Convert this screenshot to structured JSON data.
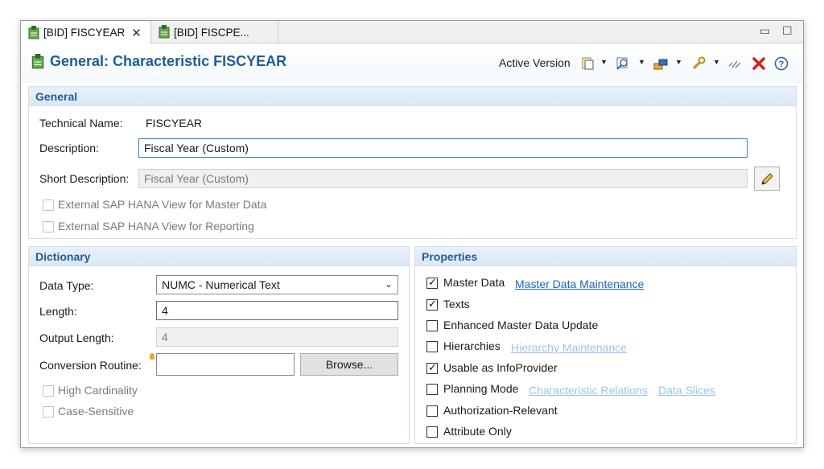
{
  "tabs": [
    {
      "label": "[BID] FISCYEAR",
      "close": "✕"
    },
    {
      "label": "[BID] FISCPE..."
    }
  ],
  "header": {
    "title": "General: Characteristic FISCYEAR",
    "active_version": "Active Version"
  },
  "general": {
    "heading": "General",
    "technical_name_label": "Technical Name:",
    "technical_name_value": "FISCYEAR",
    "description_label": "Description:",
    "description_value": "Fiscal Year (Custom)",
    "short_description_label": "Short Description:",
    "short_description_value": "Fiscal Year (Custom)",
    "hana_master_label": "External SAP HANA View for Master Data",
    "hana_reporting_label": "External SAP HANA View for Reporting"
  },
  "dictionary": {
    "heading": "Dictionary",
    "data_type_label": "Data Type:",
    "data_type_value": "NUMC - Numerical Text",
    "length_label": "Length:",
    "length_value": "4",
    "output_length_label": "Output Length:",
    "output_length_value": "4",
    "conversion_label": "Conversion Routine:",
    "conversion_value": "",
    "browse_label": "Browse...",
    "high_cardinality_label": "High Cardinality",
    "case_sensitive_label": "Case-Sensitive"
  },
  "properties": {
    "heading": "Properties",
    "items": [
      {
        "label": "Master Data",
        "checked": true
      },
      {
        "label": "Texts",
        "checked": true
      },
      {
        "label": "Enhanced Master Data Update",
        "checked": false
      },
      {
        "label": "Hierarchies",
        "checked": false
      },
      {
        "label": "Usable as InfoProvider",
        "checked": true
      },
      {
        "label": "Planning Mode",
        "checked": false
      },
      {
        "label": "Authorization-Relevant",
        "checked": false
      },
      {
        "label": "Attribute Only",
        "checked": false
      }
    ],
    "links": {
      "master_data_maintenance": "Master Data Maintenance",
      "hierarchy_maintenance": "Hierarchy Maintenance",
      "characteristic_relations": "Characteristic Relations",
      "data_slices": "Data Slices"
    }
  },
  "colors": {
    "accent": "#1f5c99",
    "link": "#1a66b8",
    "link_disabled": "#9cc4e8",
    "delete": "#d42020"
  }
}
